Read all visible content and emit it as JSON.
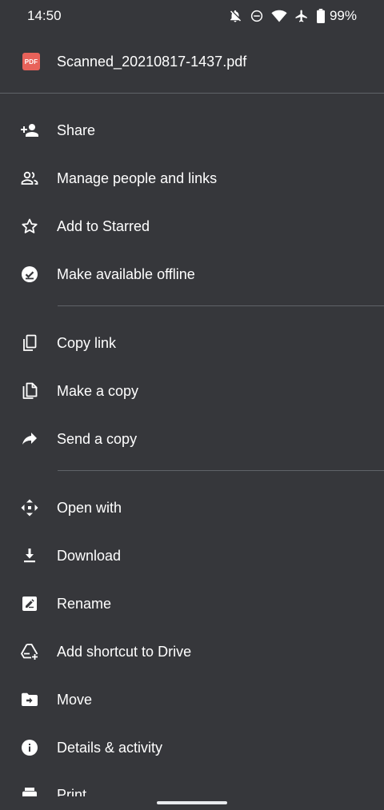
{
  "status_bar": {
    "time": "14:50",
    "icons": [
      "notifications-off-icon",
      "do-not-disturb-icon",
      "wifi-icon",
      "airplane-mode-icon",
      "battery-icon"
    ],
    "battery_percent": "99%"
  },
  "file": {
    "badge": "PDF",
    "name": "Scanned_20210817-1437.pdf",
    "badge_color": "#e8625a"
  },
  "menu": {
    "share": "Share",
    "manage_people": "Manage people and links",
    "add_starred": "Add to Starred",
    "offline": "Make available offline",
    "copy_link": "Copy link",
    "make_copy": "Make a copy",
    "send_copy": "Send a copy",
    "open_with": "Open with",
    "download": "Download",
    "rename": "Rename",
    "add_shortcut": "Add shortcut to Drive",
    "move": "Move",
    "details": "Details & activity",
    "print": "Print"
  },
  "colors": {
    "background": "#36373b",
    "text": "#ffffff",
    "divider": "#5f6368"
  }
}
